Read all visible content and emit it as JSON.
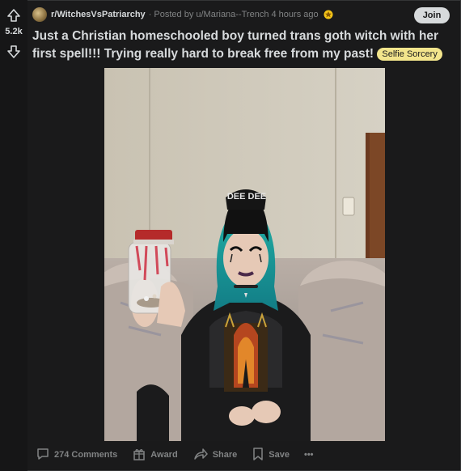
{
  "vote": {
    "score": "5.2k"
  },
  "post": {
    "subreddit": "r/WitchesVsPatriarchy",
    "posted_by": "· Posted by u/Mariana--Trench 4 hours ago",
    "join_label": "Join",
    "title": "Just a Christian homeschooled boy turned trans goth witch with her first spell!!! Trying really hard to break free from my past!",
    "flair": "Selfie Sorcery",
    "image_text": "DEE DEE"
  },
  "actions": {
    "comments": "274 Comments",
    "award": "Award",
    "share": "Share",
    "save": "Save",
    "more": "•••"
  },
  "colors": {
    "background": "#1a1a1b",
    "text": "#d7dadc",
    "muted": "#818384",
    "flair": "#f3e58c"
  },
  "icons": {
    "upvote": "arrow-up-icon",
    "downvote": "arrow-down-icon",
    "award": "award-badge-icon",
    "comments": "speech-bubble-icon",
    "gift": "gift-icon",
    "share": "share-arrow-icon",
    "save": "bookmark-icon"
  }
}
